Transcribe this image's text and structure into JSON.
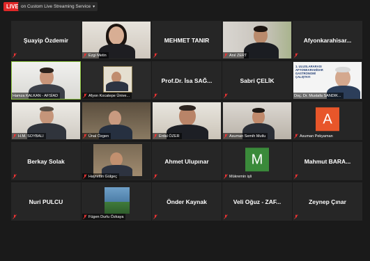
{
  "topbar": {
    "live_label": "LIVE",
    "stream_label": "on Custom Live Streaming Service"
  },
  "tiles": [
    {
      "name": "Şuayip Özdemir",
      "type": "name"
    },
    {
      "name": "Ezgi Metin",
      "type": "video"
    },
    {
      "name": "MEHMET TANIR",
      "type": "name"
    },
    {
      "name": "Anıl ZERT",
      "type": "video"
    },
    {
      "name": "Afyonkarahisar...",
      "type": "name"
    },
    {
      "name": "Hamza KALKAN - AFSİAD",
      "type": "video",
      "active": true
    },
    {
      "name": "Afyon Kocatepe Ünive...",
      "type": "video"
    },
    {
      "name": "Prof.Dr. İsa SAĞ...",
      "type": "name"
    },
    {
      "name": "Sabri ÇELİK",
      "type": "name"
    },
    {
      "name": "Doç. Dr. Mustafa SANDIK...",
      "type": "video",
      "slide_text": "1. ULUSLARARASI AFYONKARAHİSAR GASTRONOMİ ÇALIŞTAYI"
    },
    {
      "name": "H.M. SOYBALI",
      "type": "video"
    },
    {
      "name": "Ünal Özgen",
      "type": "video"
    },
    {
      "name": "Erdal ÖZER",
      "type": "video"
    },
    {
      "name": "Asuman Semih Mutlu",
      "type": "video"
    },
    {
      "name": "Asuman Pekyaman",
      "type": "avatar",
      "letter": "A",
      "color": "#e8562a"
    },
    {
      "name": "Berkay Solak",
      "type": "name"
    },
    {
      "name": "Hayrettin Gülgeç",
      "type": "video"
    },
    {
      "name": "Ahmet Ulupınar",
      "type": "name"
    },
    {
      "name": "Mükremin işli",
      "type": "avatar",
      "letter": "M",
      "color": "#3a8a3a"
    },
    {
      "name": "Mahmut BARA...",
      "type": "name"
    },
    {
      "name": "Nuri PULCU",
      "type": "name"
    },
    {
      "name": "Fügen Durlu Özkaya",
      "type": "video"
    },
    {
      "name": "Önder Kaynak",
      "type": "name"
    },
    {
      "name": "Veli Oğuz - ZAF...",
      "type": "name"
    },
    {
      "name": "Zeynep Çınar",
      "type": "name"
    }
  ]
}
